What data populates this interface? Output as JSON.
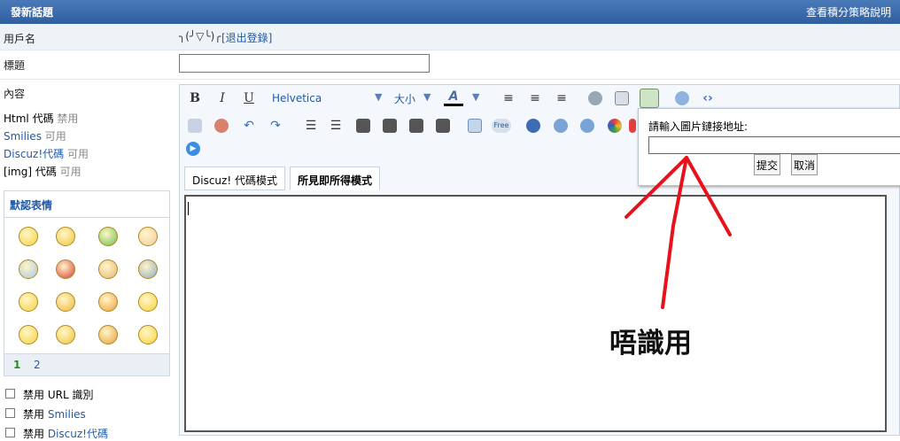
{
  "header": {
    "title": "發新話題",
    "right_link": "查看積分策略說明"
  },
  "username": {
    "label": "用戶名",
    "value": "╮(╯▽╰)╭",
    "logout": "[退出登錄]"
  },
  "title_field": {
    "label": "標題",
    "value": ""
  },
  "content": {
    "label": "內容"
  },
  "codes": [
    {
      "name": "Html 代碼",
      "state": "禁用",
      "link": false
    },
    {
      "name": "Smilies",
      "state": "可用",
      "link": true
    },
    {
      "name": "Discuz!代碼",
      "state": "可用",
      "link": true
    },
    {
      "name": "[img] 代碼",
      "state": "可用",
      "link": false
    }
  ],
  "smilies": {
    "title": "默認表情",
    "pages": [
      "1",
      "2"
    ]
  },
  "options": [
    {
      "prefix": "禁用",
      "label": "URL 識別"
    },
    {
      "prefix": "禁用",
      "label": "Smilies"
    },
    {
      "prefix": "禁用",
      "label": "Discuz!代碼"
    }
  ],
  "toolbar": {
    "bold": "B",
    "italic": "I",
    "underline": "U",
    "font": "Helvetica",
    "size": "大小",
    "color": "A"
  },
  "tabs": {
    "code": "Discuz! 代碼模式",
    "wysiwyg": "所見即所得模式"
  },
  "popup": {
    "prompt": "請輸入圖片鏈接地址:",
    "submit": "提交",
    "cancel": "取消"
  },
  "annotation": "唔識用"
}
